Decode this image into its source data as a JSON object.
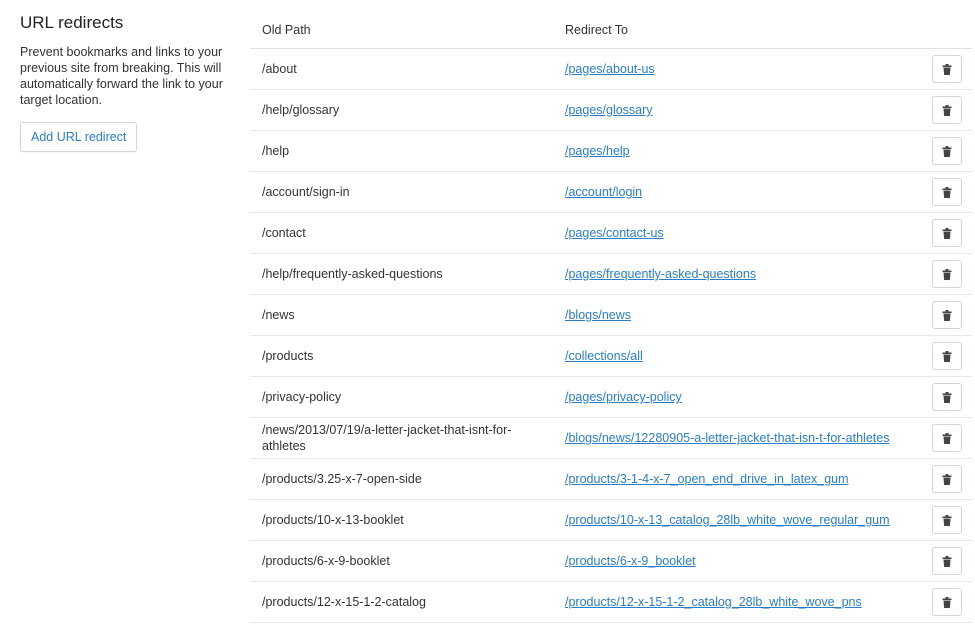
{
  "sidebar": {
    "title": "URL redirects",
    "description": "Prevent bookmarks and links to your previous site from breaking. This will automatically forward the link to your target location.",
    "add_button": "Add URL redirect"
  },
  "table": {
    "headers": [
      "Old Path",
      "Redirect To"
    ],
    "rows": [
      {
        "old": "/about",
        "target": "/pages/about-us"
      },
      {
        "old": "/help/glossary",
        "target": "/pages/glossary"
      },
      {
        "old": "/help",
        "target": "/pages/help"
      },
      {
        "old": "/account/sign-in",
        "target": "/account/login"
      },
      {
        "old": "/contact",
        "target": "/pages/contact-us"
      },
      {
        "old": "/help/frequently-asked-questions",
        "target": "/pages/frequently-asked-questions"
      },
      {
        "old": "/news",
        "target": "/blogs/news"
      },
      {
        "old": "/products",
        "target": "/collections/all"
      },
      {
        "old": "/privacy-policy",
        "target": "/pages/privacy-policy"
      },
      {
        "old": "/news/2013/07/19/a-letter-jacket-that-isnt-for-athletes",
        "target": "/blogs/news/12280905-a-letter-jacket-that-isn-t-for-athletes"
      },
      {
        "old": "/products/3.25-x-7-open-side",
        "target": "/products/3-1-4-x-7_open_end_drive_in_latex_gum"
      },
      {
        "old": "/products/10-x-13-booklet",
        "target": "/products/10-x-13_catalog_28lb_white_wove_regular_gum"
      },
      {
        "old": "/products/6-x-9-booklet",
        "target": "/products/6-x-9_booklet"
      },
      {
        "old": "/products/12-x-15-1-2-catalog",
        "target": "/products/12-x-15-1-2_catalog_28lb_white_wove_pns"
      }
    ],
    "delete_icon": "trash-icon"
  },
  "colors": {
    "link": "#2a7dc9",
    "border": "#e6e9ec"
  }
}
